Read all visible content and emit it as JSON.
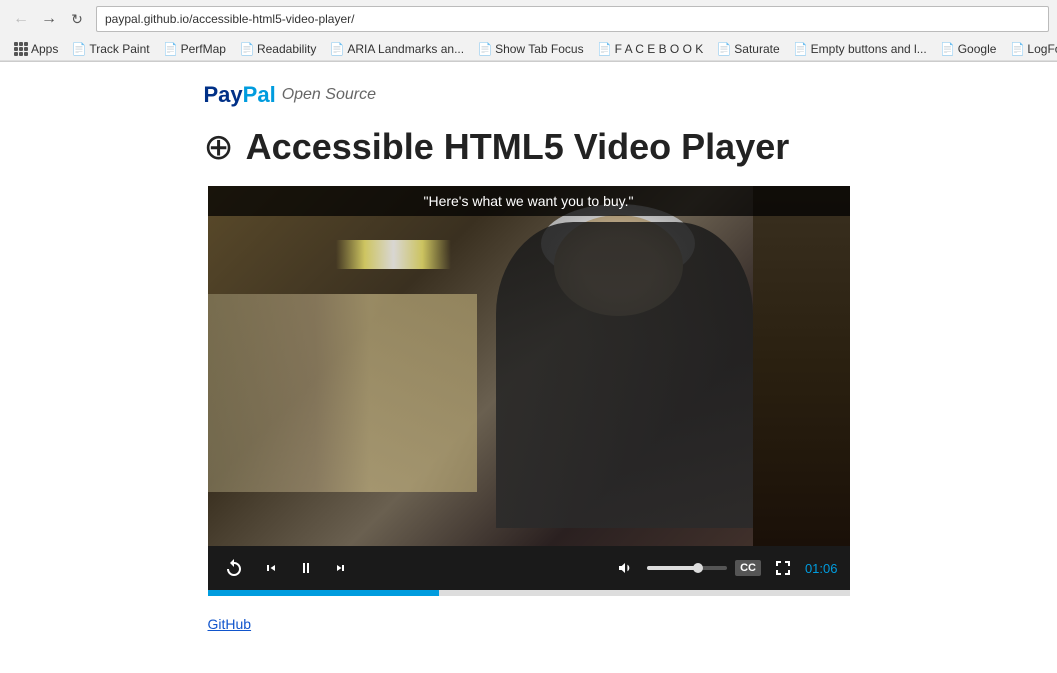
{
  "browser": {
    "url": "paypal.github.io/accessible-html5-video-player/",
    "back_btn": "←",
    "forward_btn": "→",
    "refresh_btn": "↻"
  },
  "bookmarks": {
    "apps_label": "Apps",
    "items": [
      {
        "label": "Track Paint",
        "icon": "bookmark"
      },
      {
        "label": "PerfMap",
        "icon": "bookmark"
      },
      {
        "label": "Readability",
        "icon": "bookmark"
      },
      {
        "label": "ARIA Landmarks an...",
        "icon": "bookmark"
      },
      {
        "label": "Show Tab Focus",
        "icon": "bookmark"
      },
      {
        "label": "F A C E B O O K",
        "icon": "bookmark"
      },
      {
        "label": "Saturate",
        "icon": "bookmark"
      },
      {
        "label": "Empty buttons and l...",
        "icon": "bookmark"
      },
      {
        "label": "Google",
        "icon": "bookmark"
      },
      {
        "label": "LogFo",
        "icon": "bookmark"
      }
    ]
  },
  "page": {
    "brand": {
      "pay": "Pay",
      "pal": "Pal",
      "subtitle": "Open Source"
    },
    "title": "Accessible HTML5 Video Player",
    "title_icon": "⊕",
    "video": {
      "caption": "\"Here's what we want you to buy.\"",
      "controls": {
        "replay_label": "↺",
        "rewind_label": "⏮",
        "pause_label": "⏸",
        "forward_label": "▶",
        "volume_label": "🔊",
        "cc_label": "CC",
        "fullscreen_label": "⛶",
        "time": "01:06",
        "time_separator": ":"
      },
      "progress_percent": 36
    },
    "github_link": "GitHub"
  }
}
